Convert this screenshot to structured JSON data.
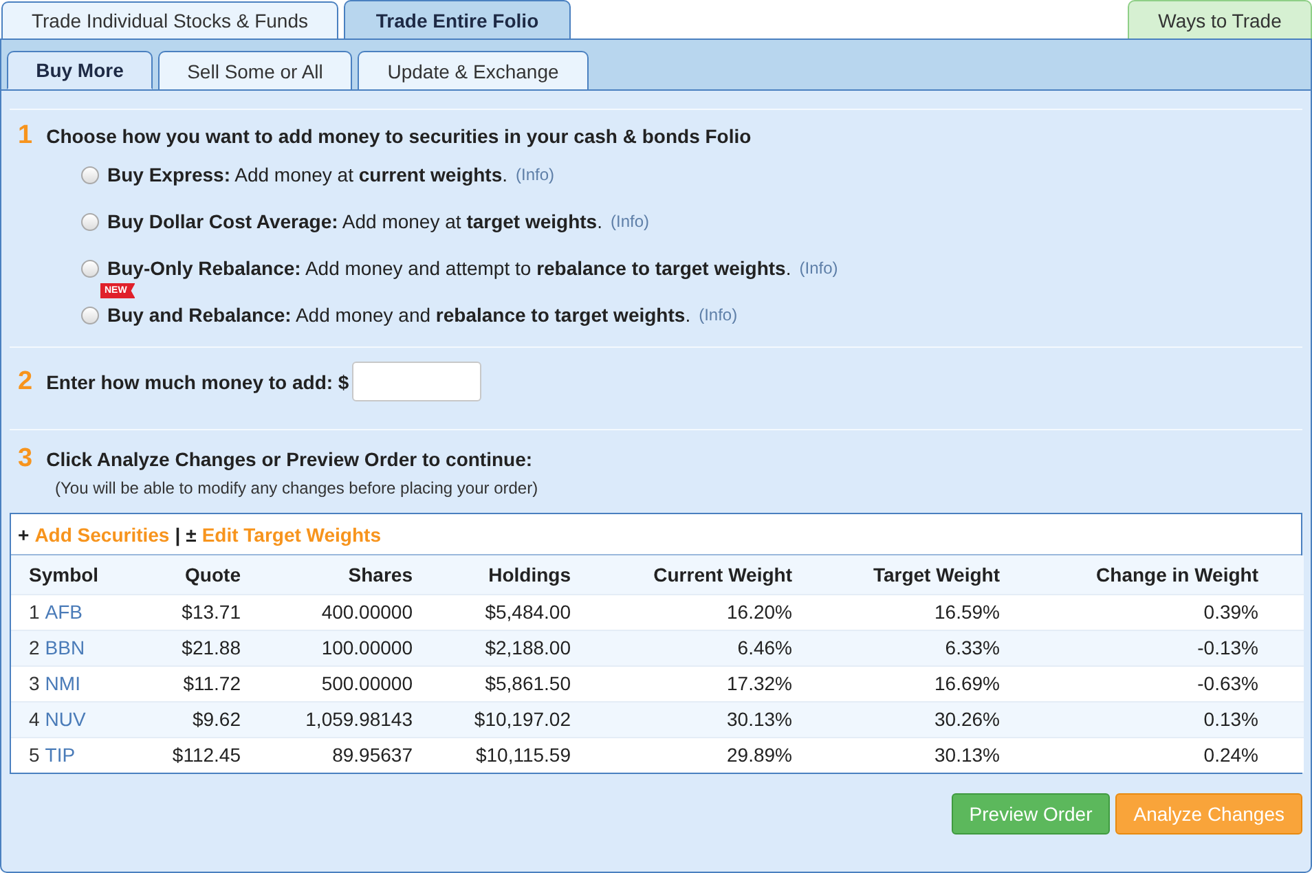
{
  "top_tabs": [
    {
      "label": "Trade Individual Stocks & Funds",
      "selected": false
    },
    {
      "label": "Trade Entire Folio",
      "selected": true
    }
  ],
  "ways_to_trade": "Ways to Trade",
  "sub_tabs": [
    {
      "label": "Buy More",
      "selected": true
    },
    {
      "label": "Sell Some or All",
      "selected": false
    },
    {
      "label": "Update & Exchange",
      "selected": false
    }
  ],
  "step1": {
    "number": "1",
    "title": "Choose how you want to add money to securities in your cash & bonds Folio",
    "options": [
      {
        "text": "**Buy Express:** Add money at **current weights**.",
        "info": "(Info)",
        "selected": false
      },
      {
        "text": "**Buy Dollar Cost Average:** Add money at **target weights**.",
        "info": "(Info)",
        "selected": false
      },
      {
        "text": "**Buy-Only Rebalance:** Add money and attempt to **rebalance to target weights**.",
        "info": "(Info)",
        "selected": false
      },
      {
        "text": "**Buy and Rebalance:** Add money and **rebalance to target weights**.",
        "info": "(Info)",
        "selected": false,
        "badge": "NEW"
      }
    ]
  },
  "step2": {
    "number": "2",
    "label": "Enter how much money to add: $"
  },
  "step3": {
    "number": "3",
    "title": "Click Analyze Changes or Preview Order to continue:",
    "note": "(You will be able to modify any changes before placing your order)"
  },
  "table_actions": [
    {
      "sign": "+",
      "label": "Add Securities"
    },
    {
      "sign": "±",
      "label": "Edit Target Weights"
    }
  ],
  "action_separator": "|",
  "table": {
    "columns": [
      "Symbol",
      "Quote",
      "Shares",
      "Holdings",
      "Current Weight",
      "Target Weight",
      "Change in Weight"
    ],
    "rows": [
      {
        "index": "1",
        "cells": [
          "AFB",
          "$13.71",
          "400.00000",
          "$5,484.00",
          "16.20%",
          "16.59%",
          "0.39%"
        ]
      },
      {
        "index": "2",
        "cells": [
          "BBN",
          "$21.88",
          "100.00000",
          "$2,188.00",
          "6.46%",
          "6.33%",
          "-0.13%"
        ]
      },
      {
        "index": "3",
        "cells": [
          "NMI",
          "$11.72",
          "500.00000",
          "$5,861.50",
          "17.32%",
          "16.69%",
          "-0.63%"
        ]
      },
      {
        "index": "4",
        "cells": [
          "NUV",
          "$9.62",
          "1,059.98143",
          "$10,197.02",
          "30.13%",
          "30.26%",
          "0.13%"
        ]
      },
      {
        "index": "5",
        "cells": [
          "TIP",
          "$112.45",
          "89.95637",
          "$10,115.59",
          "29.89%",
          "30.13%",
          "0.24%"
        ]
      }
    ]
  },
  "buttons": [
    {
      "kind": "preview",
      "label": "Preview Order"
    },
    {
      "kind": "analyze",
      "label": "Analyze Changes"
    }
  ]
}
